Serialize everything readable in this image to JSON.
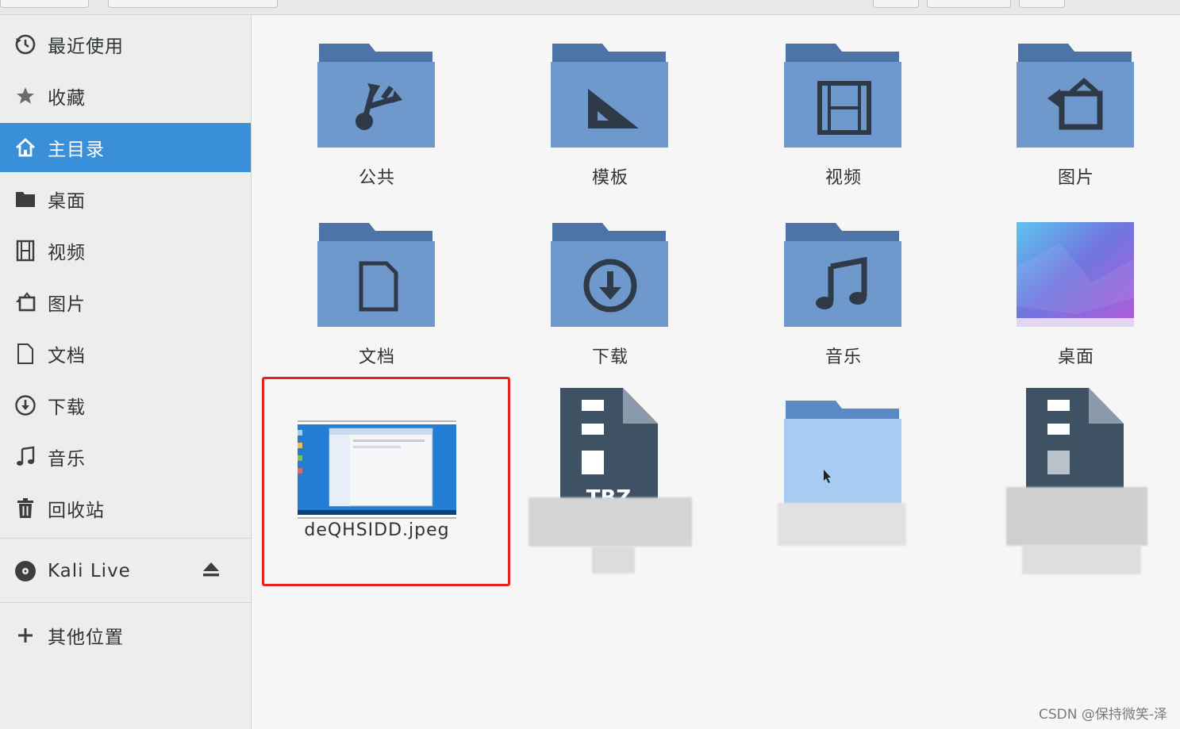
{
  "sidebar": {
    "items": [
      {
        "label": "最近使用",
        "icon": "recent-clock-icon"
      },
      {
        "label": "收藏",
        "icon": "star-icon"
      },
      {
        "label": "主目录",
        "icon": "home-icon",
        "active": true
      },
      {
        "label": "桌面",
        "icon": "folder-icon"
      },
      {
        "label": "视频",
        "icon": "film-icon"
      },
      {
        "label": "图片",
        "icon": "picture-icon"
      },
      {
        "label": "文档",
        "icon": "document-icon"
      },
      {
        "label": "下载",
        "icon": "download-icon"
      },
      {
        "label": "音乐",
        "icon": "music-note-icon"
      },
      {
        "label": "回收站",
        "icon": "trash-icon"
      }
    ],
    "devices": [
      {
        "label": "Kali Live",
        "icon": "disc-icon",
        "action_icon": "eject-icon"
      }
    ],
    "other": {
      "label": "其他位置",
      "icon": "plus-icon"
    }
  },
  "files": [
    {
      "label": "公共",
      "icon": "folder-public-icon"
    },
    {
      "label": "模板",
      "icon": "folder-templates-icon"
    },
    {
      "label": "视频",
      "icon": "folder-videos-icon"
    },
    {
      "label": "图片",
      "icon": "folder-pictures-icon"
    },
    {
      "label": "文档",
      "icon": "folder-documents-icon"
    },
    {
      "label": "下载",
      "icon": "folder-download-icon"
    },
    {
      "label": "音乐",
      "icon": "folder-music-icon"
    },
    {
      "label": "桌面",
      "icon": "desktop-thumbnail-icon"
    },
    {
      "label": "deQHSIDD.jpeg",
      "icon": "image-thumbnail-icon",
      "highlighted": true
    },
    {
      "label": "",
      "icon": "archive-icon"
    },
    {
      "label": "",
      "icon": "folder-icon"
    },
    {
      "label": "",
      "icon": "archive-icon"
    }
  ],
  "archive_text": "TBZ",
  "colors": {
    "accent": "#3a8fd9",
    "folder": "#6f98cc",
    "folder_tab": "#4d74a6",
    "highlight_border": "#e8221e"
  },
  "watermark": "CSDN @保持微笑-泽"
}
